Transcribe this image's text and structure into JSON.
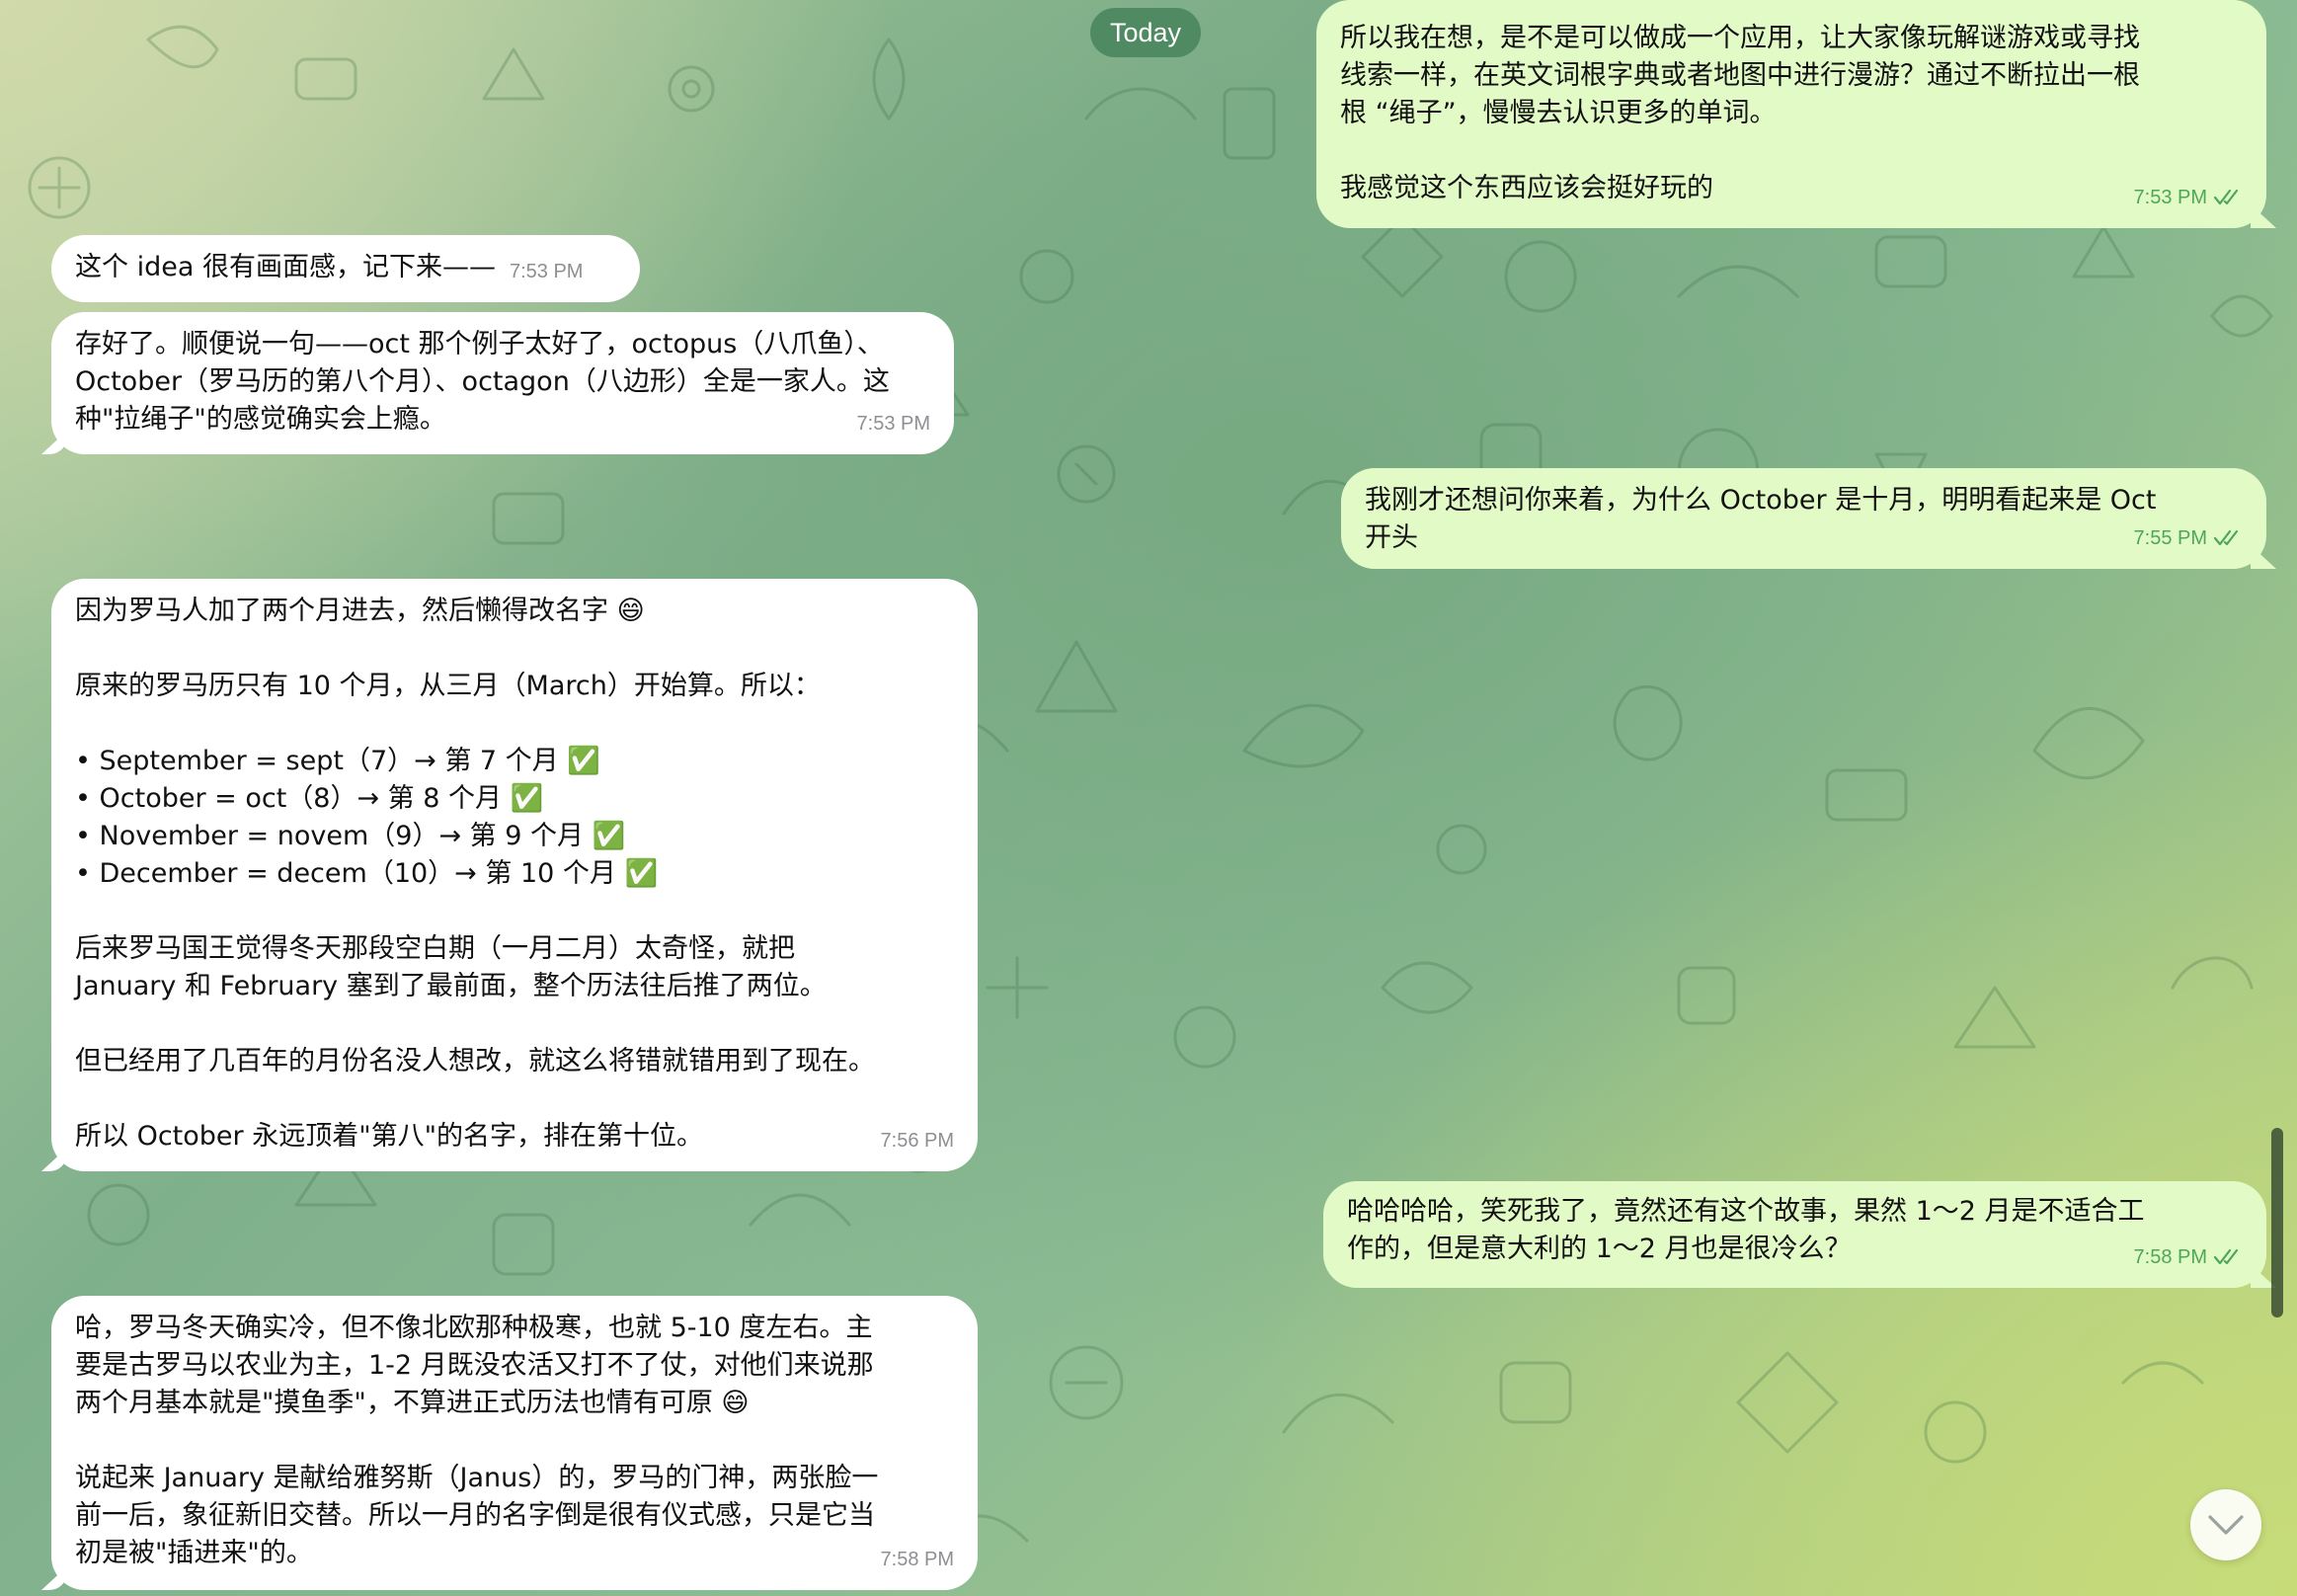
{
  "date_separator": "Today",
  "colors": {
    "outgoing_bubble": "#e2fbc6",
    "incoming_bubble": "#ffffff",
    "checkmark": "#4fa65a",
    "date_pill": "#48845c"
  },
  "messages": [
    {
      "direction": "out",
      "text": "所以我在想，是不是可以做成一个应用，让大家像玩解谜游戏或寻找\n线索一样，在英文词根字典或者地图中进行漫游？通过不断拉出一根\n根 “绳子”，慢慢去认识更多的单词。\n\n我感觉这个东西应该会挺好玩的",
      "time": "7:53 PM",
      "read": true
    },
    {
      "direction": "in",
      "text": "这个 idea 很有画面感，记下来——",
      "time": "7:53 PM"
    },
    {
      "direction": "in",
      "text": "存好了。顺便说一句——oct 那个例子太好了，octopus（八爪鱼）、\nOctober（罗马历的第八个月）、octagon（八边形）全是一家人。这\n种\"拉绳子\"的感觉确实会上瘾。",
      "time": "7:53 PM"
    },
    {
      "direction": "out",
      "text": "我刚才还想问你来着，为什么 October 是十月，明明看起来是 Oct\n开头",
      "time": "7:55 PM",
      "read": true
    },
    {
      "direction": "in",
      "text": "因为罗马人加了两个月进去，然后懒得改名字 😄\n\n原来的罗马历只有 10 个月，从三月（March）开始算。所以：\n\n• September = sept（7）→ 第 7 个月 ✅\n• October = oct（8）→ 第 8 个月 ✅\n• November = novem（9）→ 第 9 个月 ✅\n• December = decem（10）→ 第 10 个月 ✅\n\n后来罗马国王觉得冬天那段空白期（一月二月）太奇怪，就把\nJanuary 和 February 塞到了最前面，整个历法往后推了两位。\n\n但已经用了几百年的月份名没人想改，就这么将错就错用到了现在。\n\n所以 October 永远顶着\"第八\"的名字，排在第十位。",
      "time": "7:56 PM"
    },
    {
      "direction": "out",
      "text": "哈哈哈哈，笑死我了，竟然还有这个故事，果然 1～2 月是不适合工\n作的，但是意大利的 1～2 月也是很冷么？",
      "time": "7:58 PM",
      "read": true
    },
    {
      "direction": "in",
      "text": "哈，罗马冬天确实冷，但不像北欧那种极寒，也就 5-10 度左右。主\n要是古罗马以农业为主，1-2 月既没农活又打不了仗，对他们来说那\n两个月基本就是\"摸鱼季\"，不算进正式历法也情有可原 😄\n\n说起来 January 是献给雅努斯（Janus）的，罗马的门神，两张脸一\n前一后，象征新旧交替。所以一月的名字倒是很有仪式感，只是它当\n初是被\"插进来\"的。",
      "time": "7:58 PM"
    }
  ]
}
